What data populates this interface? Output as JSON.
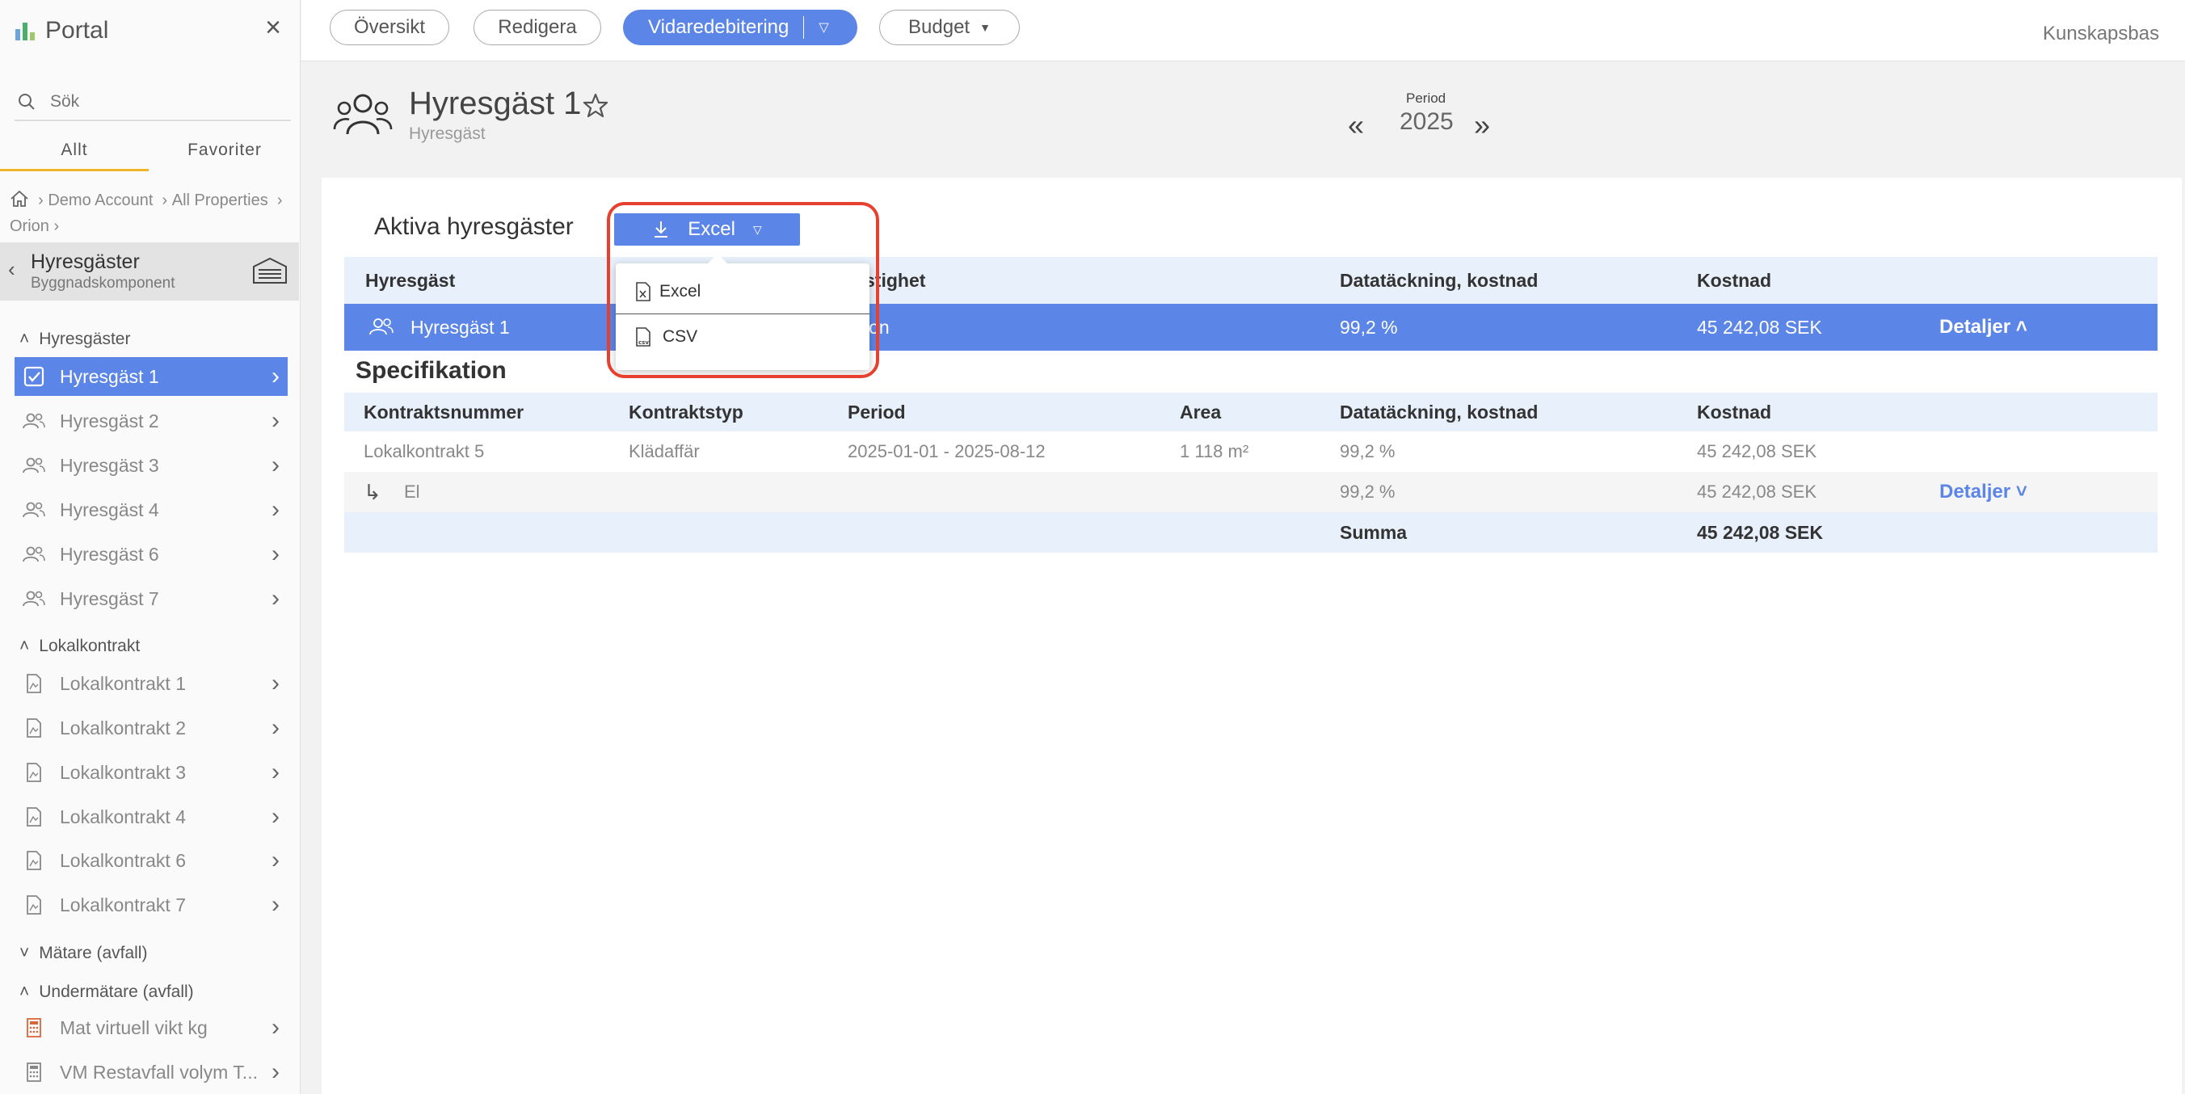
{
  "sidebar": {
    "brand": "Portal",
    "search_placeholder": "Sök",
    "tabs": {
      "all": "Allt",
      "favorites": "Favoriter"
    },
    "breadcrumb": [
      "Demo Account",
      "All Properties",
      "Orion"
    ],
    "section": {
      "title": "Hyresgäster",
      "subtitle": "Byggnadskomponent"
    },
    "groups": {
      "tenants": "Hyresgäster",
      "contracts": "Lokalkontrakt",
      "meters": "Mätare (avfall)",
      "submeters": "Undermätare (avfall)"
    },
    "tenant_items": [
      "Hyresgäst 1",
      "Hyresgäst 2",
      "Hyresgäst 3",
      "Hyresgäst 4",
      "Hyresgäst 6",
      "Hyresgäst 7"
    ],
    "contract_items": [
      "Lokalkontrakt 1",
      "Lokalkontrakt 2",
      "Lokalkontrakt 3",
      "Lokalkontrakt 4",
      "Lokalkontrakt 6",
      "Lokalkontrakt 7"
    ],
    "submeter_items": [
      "Mat virtuell vikt kg",
      "VM Restavfall volym T..."
    ]
  },
  "topbar": {
    "tabs": [
      "Översikt",
      "Redigera",
      "Vidaredebitering",
      "Budget"
    ],
    "knowledge_base": "Kunskapsbas"
  },
  "header": {
    "title": "Hyresgäst 1",
    "subtitle": "Hyresgäst",
    "period_label": "Period",
    "period_value": "2025"
  },
  "active": {
    "title": "Aktiva hyresgäster",
    "export_label": "Excel",
    "dropdown": [
      "Excel",
      "CSV"
    ],
    "headers": [
      "Hyresgäst",
      "stighet",
      "Datatäckning, kostnad",
      "Kostnad"
    ],
    "row": {
      "tenant": "Hyresgäst 1",
      "property": "ion",
      "coverage": "99,2 %",
      "cost": "45 242,08 SEK",
      "details": "Detaljer"
    }
  },
  "spec": {
    "title": "Specifikation",
    "headers": [
      "Kontraktsnummer",
      "Kontraktstyp",
      "Period",
      "Area",
      "Datatäckning, kostnad",
      "Kostnad"
    ],
    "rows": [
      {
        "contract": "Lokalkontrakt 5",
        "type": "Klädaffär",
        "period": "2025-01-01 - 2025-08-12",
        "area": "1 118 m²",
        "coverage": "99,2 %",
        "cost": "45 242,08 SEK"
      },
      {
        "contract": "El",
        "coverage": "99,2 %",
        "cost": "45 242,08 SEK",
        "details": "Detaljer"
      }
    ],
    "sum_label": "Summa",
    "sum_value": "45 242,08 SEK"
  },
  "colors": {
    "accent": "#5b85e6",
    "highlight": "#e8402f",
    "tab_underline": "#f0b429"
  }
}
